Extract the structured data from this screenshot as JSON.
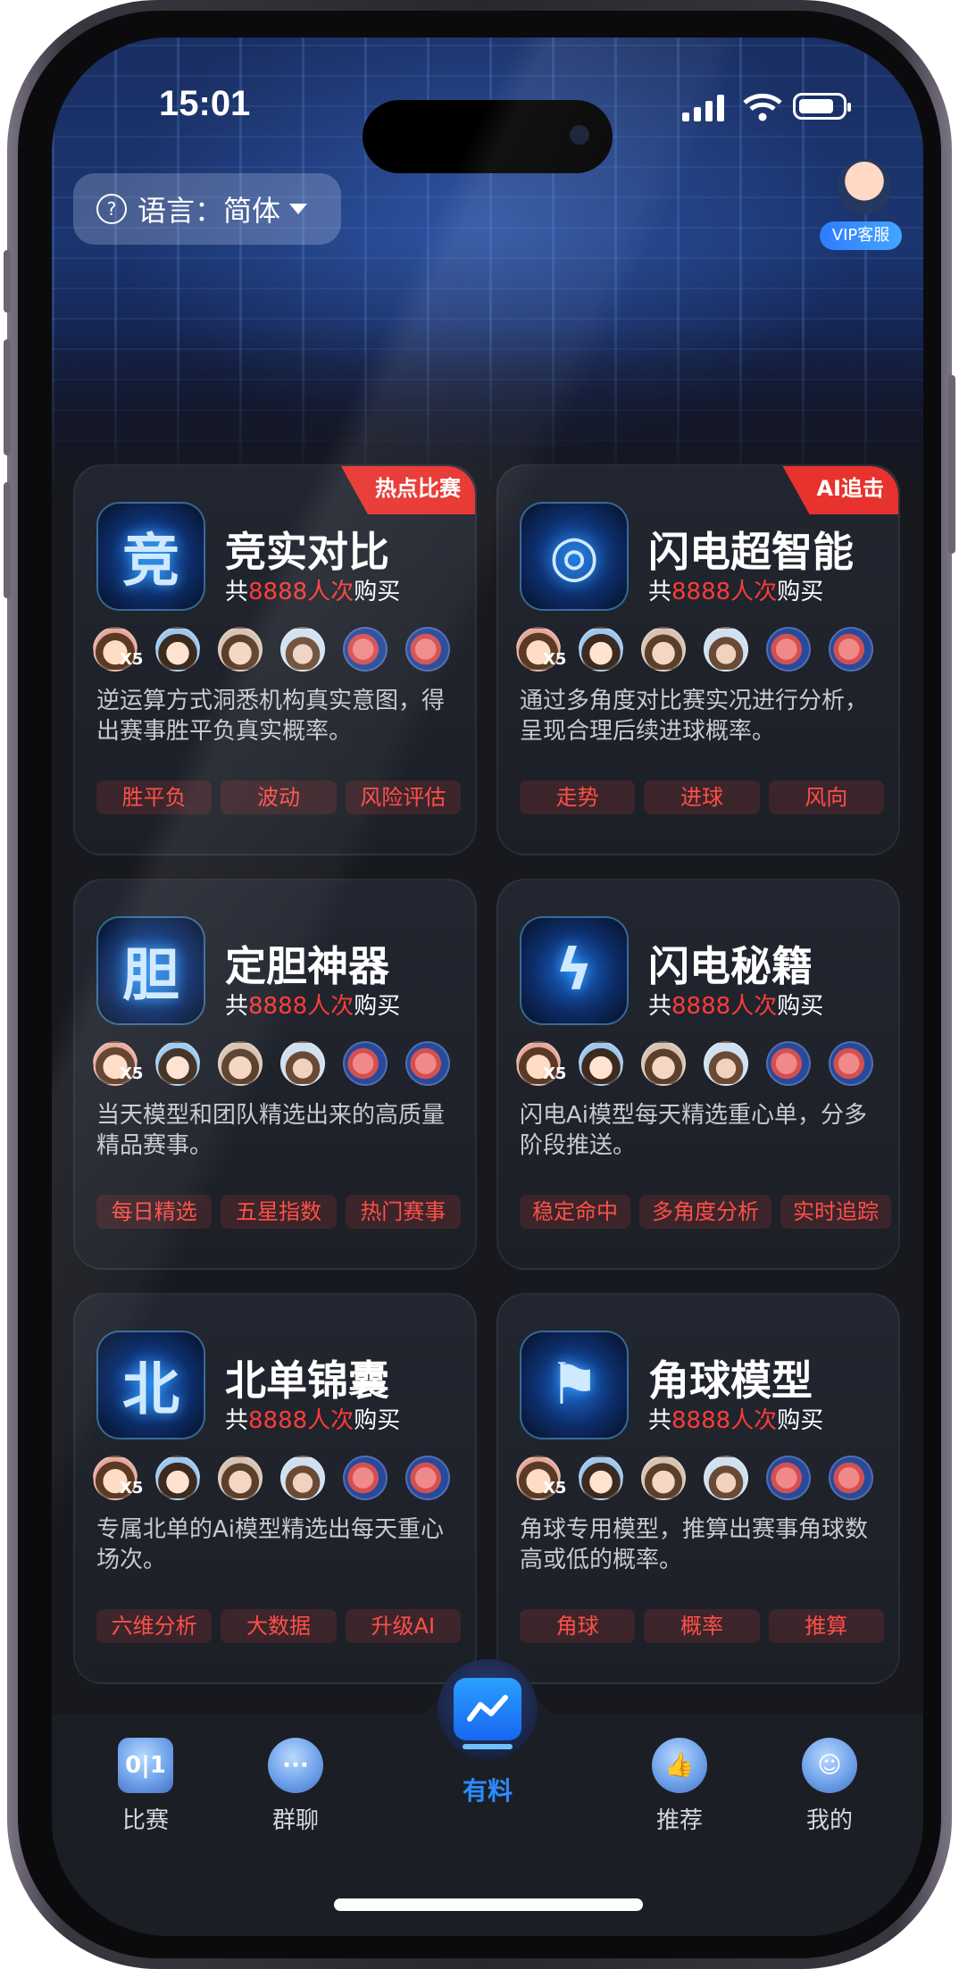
{
  "status_bar": {
    "time": "15:01"
  },
  "header": {
    "language_label": "语言：简体",
    "vip_label": "VIP客服"
  },
  "colors": {
    "accent": "#2b8cff",
    "highlight": "#ff3b38",
    "ribbon": "#e8322d",
    "background": "#17191f"
  },
  "cards": [
    {
      "ribbon": "热点比赛",
      "icon": "竞",
      "title": "竞实对比",
      "buy_prefix": "共",
      "buy_count": "8888人次",
      "buy_suffix": "购买",
      "avatar_badge": "X5",
      "description": "逆运算方式洞悉机构真实意图，得出赛事胜平负真实概率。",
      "tags": [
        "胜平负",
        "波动",
        "风险评估"
      ]
    },
    {
      "ribbon": "AI追击",
      "icon": "◎",
      "title": "闪电超智能",
      "buy_prefix": "共",
      "buy_count": "8888人次",
      "buy_suffix": "购买",
      "avatar_badge": "X5",
      "description": "通过多角度对比赛实况进行分析，呈现合理后续进球概率。",
      "tags": [
        "走势",
        "进球",
        "风向"
      ]
    },
    {
      "ribbon": "",
      "icon": "胆",
      "title": "定胆神器",
      "buy_prefix": "共",
      "buy_count": "8888人次",
      "buy_suffix": "购买",
      "avatar_badge": "X5",
      "description": "当天模型和团队精选出来的高质量精品赛事。",
      "tags": [
        "每日精选",
        "五星指数",
        "热门赛事"
      ]
    },
    {
      "ribbon": "",
      "icon": "ϟ",
      "title": "闪电秘籍",
      "buy_prefix": "共",
      "buy_count": "8888人次",
      "buy_suffix": "购买",
      "avatar_badge": "X5",
      "description": "闪电Ai模型每天精选重心单，分多阶段推送。",
      "tags": [
        "稳定命中",
        "多角度分析",
        "实时追踪"
      ]
    },
    {
      "ribbon": "",
      "icon": "北",
      "title": "北单锦囊",
      "buy_prefix": "共",
      "buy_count": "8888人次",
      "buy_suffix": "购买",
      "avatar_badge": "X5",
      "description": "专属北单的Ai模型精选出每天重心场次。",
      "tags": [
        "六维分析",
        "大数据",
        "升级AI"
      ]
    },
    {
      "ribbon": "",
      "icon": "⚑",
      "title": "角球模型",
      "buy_prefix": "共",
      "buy_count": "8888人次",
      "buy_suffix": "购买",
      "avatar_badge": "X5",
      "description": "角球专用模型，推算出赛事角球数高或低的概率。",
      "tags": [
        "角球",
        "概率",
        "推算"
      ]
    }
  ],
  "tabbar": {
    "tabs": [
      {
        "label": "比赛",
        "icon": "calendar-icon",
        "glyph": "0|1"
      },
      {
        "label": "群聊",
        "icon": "chat-icon",
        "glyph": "···"
      },
      {
        "label": "有料",
        "icon": "chart-icon",
        "glyph": ""
      },
      {
        "label": "推荐",
        "icon": "thumb-up-icon",
        "glyph": "👍"
      },
      {
        "label": "我的",
        "icon": "user-icon",
        "glyph": "☺"
      }
    ],
    "active": "有料"
  }
}
